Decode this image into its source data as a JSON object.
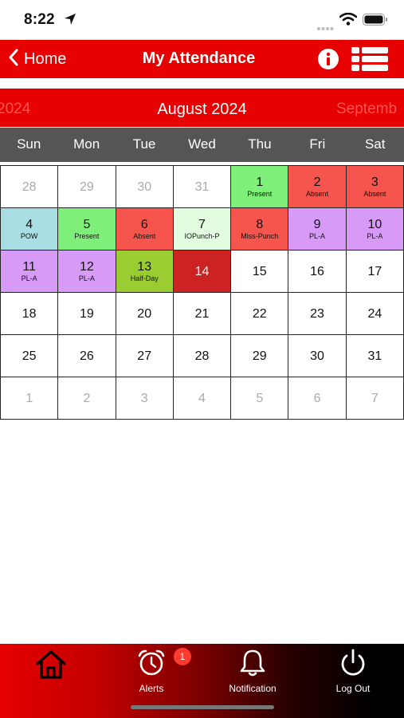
{
  "status_bar": {
    "time": "8:22"
  },
  "header": {
    "back_label": "Home",
    "title": "My Attendance"
  },
  "month_bar": {
    "prev": "2024",
    "current": "August 2024",
    "next": "Septemb"
  },
  "weekdays": [
    "Sun",
    "Mon",
    "Tue",
    "Wed",
    "Thu",
    "Fri",
    "Sat"
  ],
  "status_colors": {
    "present": "#7ef07a",
    "absent": "#f5554c",
    "pow": "#a8dde3",
    "iopunch": "#e2fce0",
    "pl_a": "#d79af7",
    "half_day": "#9acd32",
    "today": "#cc2222"
  },
  "calendar": [
    {
      "day": "28",
      "label": ""
    },
    {
      "day": "29",
      "label": ""
    },
    {
      "day": "30",
      "label": ""
    },
    {
      "day": "31",
      "label": ""
    },
    {
      "day": "1",
      "label": "Present"
    },
    {
      "day": "2",
      "label": "Absent"
    },
    {
      "day": "3",
      "label": "Absent"
    },
    {
      "day": "4",
      "label": "POW"
    },
    {
      "day": "5",
      "label": "Present"
    },
    {
      "day": "6",
      "label": "Absent"
    },
    {
      "day": "7",
      "label": "IOPunch-P"
    },
    {
      "day": "8",
      "label": "Miss-Punch"
    },
    {
      "day": "9",
      "label": "PL-A"
    },
    {
      "day": "10",
      "label": "PL-A"
    },
    {
      "day": "11",
      "label": "PL-A"
    },
    {
      "day": "12",
      "label": "PL-A"
    },
    {
      "day": "13",
      "label": "Half-Day"
    },
    {
      "day": "14",
      "label": ""
    },
    {
      "day": "15",
      "label": ""
    },
    {
      "day": "16",
      "label": ""
    },
    {
      "day": "17",
      "label": ""
    },
    {
      "day": "18",
      "label": ""
    },
    {
      "day": "19",
      "label": ""
    },
    {
      "day": "20",
      "label": ""
    },
    {
      "day": "21",
      "label": ""
    },
    {
      "day": "22",
      "label": ""
    },
    {
      "day": "23",
      "label": ""
    },
    {
      "day": "24",
      "label": ""
    },
    {
      "day": "25",
      "label": ""
    },
    {
      "day": "26",
      "label": ""
    },
    {
      "day": "27",
      "label": ""
    },
    {
      "day": "28",
      "label": ""
    },
    {
      "day": "29",
      "label": ""
    },
    {
      "day": "30",
      "label": ""
    },
    {
      "day": "31",
      "label": ""
    },
    {
      "day": "1",
      "label": ""
    },
    {
      "day": "2",
      "label": ""
    },
    {
      "day": "3",
      "label": ""
    },
    {
      "day": "4",
      "label": ""
    },
    {
      "day": "5",
      "label": ""
    },
    {
      "day": "6",
      "label": ""
    },
    {
      "day": "7",
      "label": ""
    }
  ],
  "tabbar": {
    "home_icon": "home-icon",
    "alerts_label": "Alerts",
    "alerts_badge": "1",
    "notification_label": "Notification",
    "logout_label": "Log Out"
  }
}
